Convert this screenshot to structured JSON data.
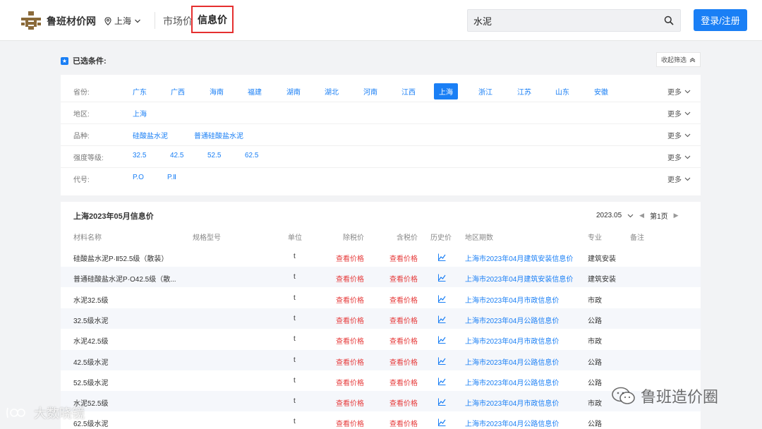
{
  "header": {
    "brand": "鲁班材价网",
    "location": "上海",
    "nav_market": "市场价",
    "nav_info": "信息价",
    "search_value": "水泥",
    "login_label": "登录/注册"
  },
  "filters": {
    "selected_title": "已选条件:",
    "collapse_label": "收起筛选",
    "more_label": "更多",
    "rows": [
      {
        "label": "省份:",
        "options": [
          "广东",
          "广西",
          "海南",
          "福建",
          "湖南",
          "湖北",
          "河南",
          "江西",
          "上海",
          "浙江",
          "江苏",
          "山东",
          "安徽"
        ],
        "active": "上海"
      },
      {
        "label": "地区:",
        "options": [
          "上海"
        ]
      },
      {
        "label": "品种:",
        "options": [
          "硅酸盐水泥",
          "普通硅酸盐水泥"
        ]
      },
      {
        "label": "强度等级:",
        "options": [
          "32.5",
          "42.5",
          "52.5",
          "62.5"
        ]
      },
      {
        "label": "代号:",
        "options": [
          "P.O",
          "P.Ⅱ"
        ]
      }
    ]
  },
  "table": {
    "title": "上海2023年05月信息价",
    "period": "2023.05",
    "page_label": "第1页",
    "columns": [
      "材料名称",
      "规格型号",
      "单位",
      "除税价",
      "含税价",
      "历史价",
      "地区期数",
      "专业",
      "备注"
    ],
    "rows": [
      {
        "name": "硅酸盐水泥P·Ⅱ52.5级（散装）",
        "unit": "t",
        "ex_tax": "查看价格",
        "in_tax": "查看价格",
        "period": "上海市2023年04月建筑安装信息价",
        "major": "建筑安装"
      },
      {
        "name": "普通硅酸盐水泥P·O42.5级（散...",
        "unit": "t",
        "ex_tax": "查看价格",
        "in_tax": "查看价格",
        "period": "上海市2023年04月建筑安装信息价",
        "major": "建筑安装"
      },
      {
        "name": "水泥32.5级",
        "unit": "t",
        "ex_tax": "查看价格",
        "in_tax": "查看价格",
        "period": "上海市2023年04月市政信息价",
        "major": "市政"
      },
      {
        "name": "32.5级水泥",
        "unit": "t",
        "ex_tax": "查看价格",
        "in_tax": "查看价格",
        "period": "上海市2023年04月公路信息价",
        "major": "公路"
      },
      {
        "name": "水泥42.5级",
        "unit": "t",
        "ex_tax": "查看价格",
        "in_tax": "查看价格",
        "period": "上海市2023年04月市政信息价",
        "major": "市政"
      },
      {
        "name": "42.5级水泥",
        "unit": "t",
        "ex_tax": "查看价格",
        "in_tax": "查看价格",
        "period": "上海市2023年04月公路信息价",
        "major": "公路"
      },
      {
        "name": "52.5级水泥",
        "unit": "t",
        "ex_tax": "查看价格",
        "in_tax": "查看价格",
        "period": "上海市2023年04月公路信息价",
        "major": "公路"
      },
      {
        "name": "水泥52.5级",
        "unit": "t",
        "ex_tax": "查看价格",
        "in_tax": "查看价格",
        "period": "上海市2023年04月市政信息价",
        "major": "市政"
      },
      {
        "name": "62.5级水泥",
        "unit": "t",
        "ex_tax": "查看价格",
        "in_tax": "查看价格",
        "period": "上海市2023年04月公路信息价",
        "major": "公路"
      }
    ]
  },
  "watermarks": {
    "left": "大数晓镜",
    "right": "鲁班造价圈"
  },
  "colors": {
    "accent": "#1a7ff5",
    "price_link": "#e63b3b",
    "highlight_border": "#e52f2f"
  }
}
